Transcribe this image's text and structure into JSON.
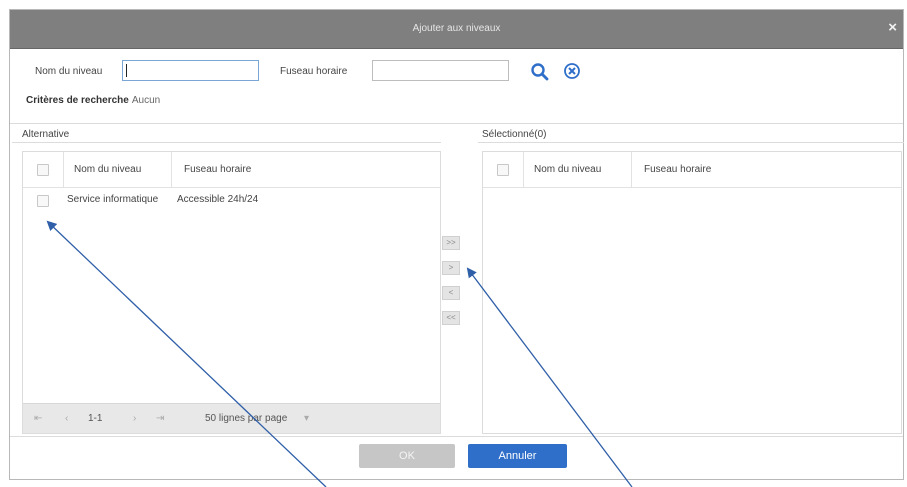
{
  "dialog": {
    "title": "Ajouter aux niveaux",
    "close_glyph": "×"
  },
  "search": {
    "level_name_label": "Nom du niveau",
    "level_name_value": "",
    "timezone_label": "Fuseau horaire",
    "timezone_value": "",
    "search_icon": "search-icon",
    "clear_icon": "clear-circle-icon"
  },
  "criteria": {
    "label": "Critères de recherche",
    "value": "Aucun"
  },
  "left_panel": {
    "title": "Alternative",
    "columns": [
      "Nom du niveau",
      "Fuseau horaire"
    ],
    "rows": [
      {
        "level_name": "Service informatique",
        "timezone": "Accessible 24h/24"
      }
    ],
    "pager": {
      "first": "⇤",
      "prev": "‹",
      "range": "1-1",
      "next": "›",
      "last": "⇥",
      "per_page": "50 lignes par page",
      "dropdown": "▾"
    }
  },
  "right_panel": {
    "title": "Sélectionné(0)",
    "columns": [
      "Nom du niveau",
      "Fuseau horaire"
    ],
    "rows": []
  },
  "movers": {
    "move_all_right": ">>",
    "move_right": ">",
    "move_left": "<",
    "move_all_left": "<<"
  },
  "footer": {
    "ok_label": "OK",
    "cancel_label": "Annuler"
  },
  "colors": {
    "titlebar": "#7f7f7f",
    "accent": "#2f6fc9",
    "arrow": "#2f5fa8"
  }
}
